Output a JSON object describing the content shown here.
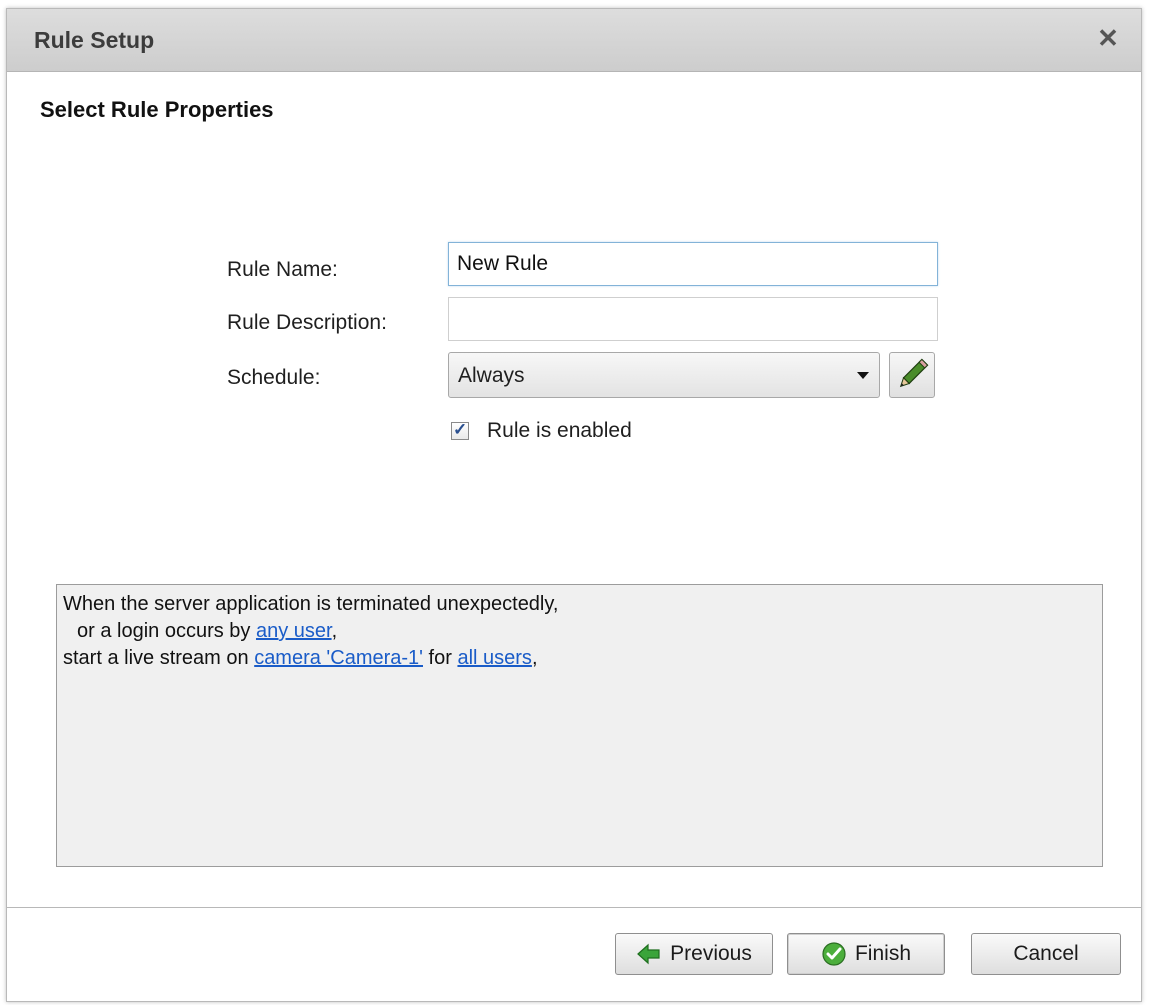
{
  "window": {
    "title": "Rule Setup",
    "close_glyph": "✕"
  },
  "page": {
    "heading": "Select Rule Properties"
  },
  "form": {
    "rule_name_label": "Rule Name:",
    "rule_name_value": "New Rule",
    "rule_description_label": "Rule Description:",
    "rule_description_value": "",
    "schedule_label": "Schedule:",
    "schedule_value": "Always",
    "enabled_label": "Rule is enabled",
    "enabled_checked": true,
    "checkmark_glyph": "✓"
  },
  "summary": {
    "line1": "When the server application is terminated unexpectedly,",
    "line2_prefix": "or a login occurs by ",
    "line2_link": "any user",
    "line2_suffix": ",",
    "line3_prefix": "start a live stream on ",
    "line3_link1": "camera 'Camera-1'",
    "line3_middle": " for ",
    "line3_link2": "all users",
    "line3_suffix": ","
  },
  "buttons": {
    "previous": "Previous",
    "finish": "Finish",
    "cancel": "Cancel"
  },
  "icons": {
    "edit": "pencil-icon",
    "previous": "green-left-arrow-icon",
    "finish": "green-check-circle-icon",
    "close": "close-icon",
    "schedule_dropdown": "chevron-down-icon"
  },
  "colors": {
    "link": "#1a5cc8",
    "titlebar": "#d4d4d4",
    "summary_bg": "#f0f0f0",
    "arrow_green": "#3aa43a"
  }
}
